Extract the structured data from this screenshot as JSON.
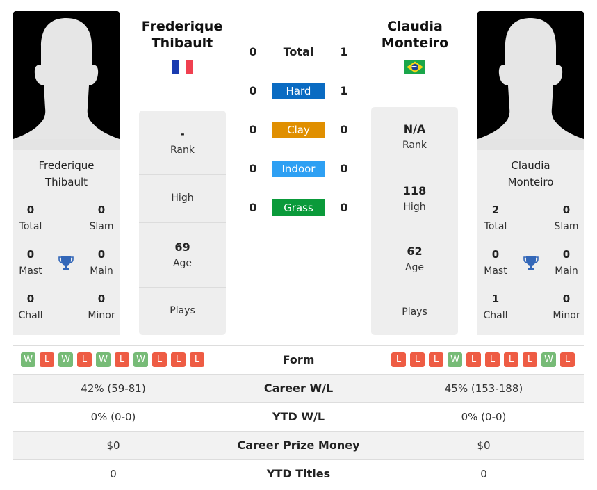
{
  "colors": {
    "hard": "#0a6bc2",
    "clay": "#e08f00",
    "indoor": "#2ea0f3",
    "grass": "#0a9a3a",
    "win": "#77bb77",
    "loss": "#ee5c44",
    "trophy": "#3367b8"
  },
  "player1": {
    "name": "Frederique Thibault",
    "name_line1": "Frederique",
    "name_line2": "Thibault",
    "country_flag": "france-flag",
    "titles": {
      "total": {
        "value": "0",
        "label": "Total"
      },
      "slam": {
        "value": "0",
        "label": "Slam"
      },
      "mast": {
        "value": "0",
        "label": "Mast"
      },
      "main": {
        "value": "0",
        "label": "Main"
      },
      "chall": {
        "value": "0",
        "label": "Chall"
      },
      "minor": {
        "value": "0",
        "label": "Minor"
      }
    },
    "info": {
      "rank": {
        "value": "-",
        "label": "Rank"
      },
      "high": {
        "value": "",
        "label": "High"
      },
      "age": {
        "value": "69",
        "label": "Age"
      },
      "plays": {
        "value": "",
        "label": "Plays"
      }
    },
    "form": [
      "W",
      "L",
      "W",
      "L",
      "W",
      "L",
      "W",
      "L",
      "L",
      "L"
    ],
    "career_wl": "42% (59-81)",
    "ytd_wl": "0% (0-0)",
    "career_prize": "$0",
    "ytd_titles": "0"
  },
  "player2": {
    "name": "Claudia Monteiro",
    "name_line1": "Claudia",
    "name_line2": "Monteiro",
    "country_flag": "brazil-flag",
    "titles": {
      "total": {
        "value": "2",
        "label": "Total"
      },
      "slam": {
        "value": "0",
        "label": "Slam"
      },
      "mast": {
        "value": "0",
        "label": "Mast"
      },
      "main": {
        "value": "0",
        "label": "Main"
      },
      "chall": {
        "value": "1",
        "label": "Chall"
      },
      "minor": {
        "value": "0",
        "label": "Minor"
      }
    },
    "info": {
      "rank": {
        "value": "N/A",
        "label": "Rank"
      },
      "high": {
        "value": "118",
        "label": "High"
      },
      "age": {
        "value": "62",
        "label": "Age"
      },
      "plays": {
        "value": "",
        "label": "Plays"
      }
    },
    "form": [
      "L",
      "L",
      "L",
      "W",
      "L",
      "L",
      "L",
      "L",
      "W",
      "L"
    ],
    "career_wl": "45% (153-188)",
    "ytd_wl": "0% (0-0)",
    "career_prize": "$0",
    "ytd_titles": "0"
  },
  "h2h": {
    "total": {
      "label": "Total",
      "p1": "0",
      "p2": "1"
    },
    "hard": {
      "label": "Hard",
      "p1": "0",
      "p2": "1"
    },
    "clay": {
      "label": "Clay",
      "p1": "0",
      "p2": "0"
    },
    "indoor": {
      "label": "Indoor",
      "p1": "0",
      "p2": "0"
    },
    "grass": {
      "label": "Grass",
      "p1": "0",
      "p2": "0"
    }
  },
  "table": {
    "form_label": "Form",
    "career_wl_label": "Career W/L",
    "ytd_wl_label": "YTD W/L",
    "career_prize_label": "Career Prize Money",
    "ytd_titles_label": "YTD Titles"
  }
}
